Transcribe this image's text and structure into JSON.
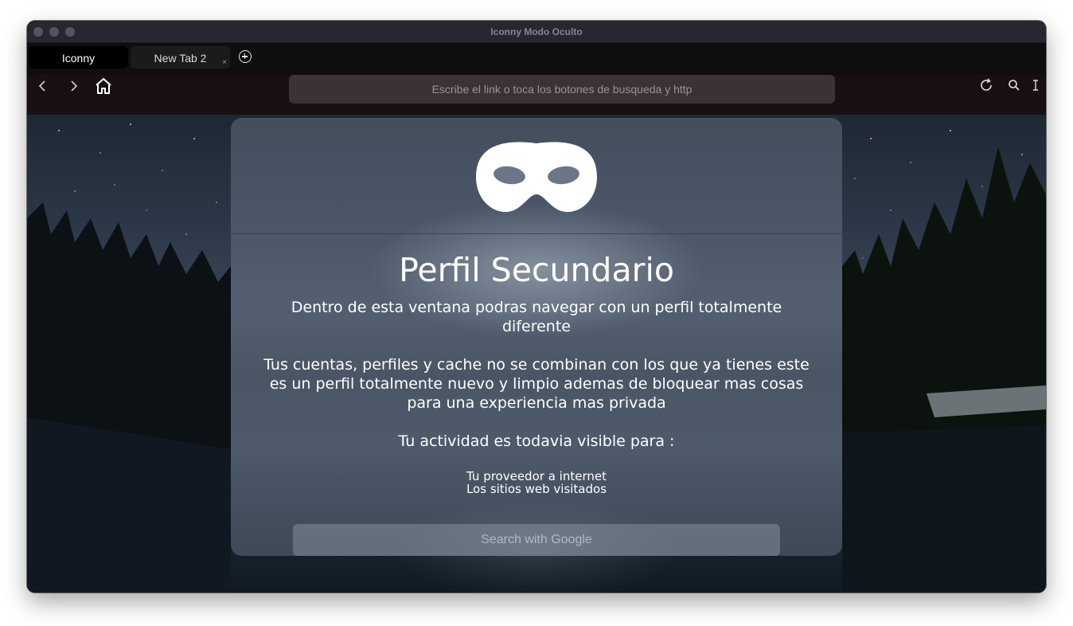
{
  "window": {
    "title": "Iconny Modo Oculto"
  },
  "tabs": [
    {
      "label": "Iconny",
      "active": true
    },
    {
      "label": "New Tab 2",
      "active": false,
      "close": "×"
    }
  ],
  "toolbar": {
    "address_placeholder": "Escribe el link o toca los botones de busqueda y http",
    "icons": [
      "back-icon",
      "forward-icon",
      "home-icon",
      "reload-icon",
      "search-icon",
      "text-cursor-icon"
    ]
  },
  "card": {
    "icon": "incognito-mask-icon",
    "title": "Perfil Secundario",
    "paragraph1": "Dentro de esta ventana podras navegar con un perfil totalmente diferente",
    "paragraph2": "Tus cuentas, perfiles y cache no se combinan con los que ya tienes este es un perfil totalmente nuevo y limpio ademas de bloquear mas cosas para una experiencia mas privada",
    "visibility_heading": "Tu actividad es todavia visible para :",
    "visible_to": [
      "Tu proveedor a internet",
      "Los sitios web visitados"
    ],
    "search_placeholder": "Search with Google"
  }
}
